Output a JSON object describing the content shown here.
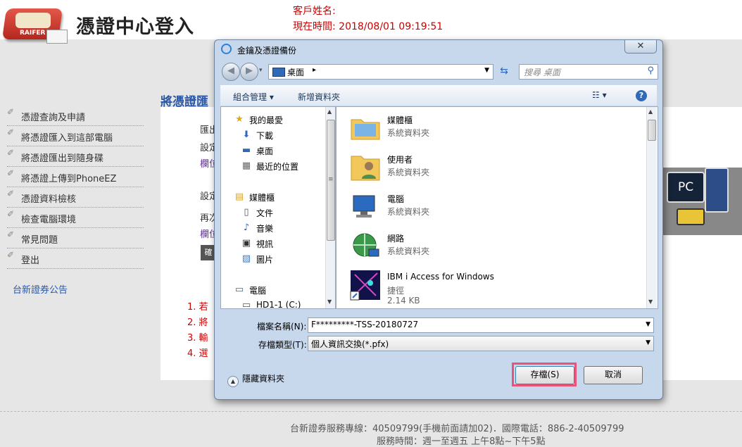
{
  "header": {
    "logo_text": "RAIFER",
    "title": "憑證中心登入",
    "customer_label": "客戶姓名:",
    "time_label": "現在時間: 2018/08/01 09:19:51"
  },
  "sidebar": {
    "items": [
      {
        "label": "憑證查詢及申請"
      },
      {
        "label": "將憑證匯入到這部電腦"
      },
      {
        "label": "將憑證匯出到隨身碟"
      },
      {
        "label": "將憑證上傳到PhoneEZ"
      },
      {
        "label": "憑證資料檢核"
      },
      {
        "label": "檢查電腦環境"
      },
      {
        "label": "常見問題"
      },
      {
        "label": "登出"
      }
    ],
    "notice": "台新證券公告"
  },
  "main": {
    "section_title": "將憑證匯",
    "fragments": [
      "匯出",
      "設定",
      "欄位",
      "設定",
      "再次",
      "欄位"
    ],
    "gray_button": "確",
    "list_numbers": [
      "1. 若",
      "2. 將",
      "3. 輸",
      "4. 選"
    ],
    "pc_label": "PC"
  },
  "footer": {
    "line1": "台新證券服務專線：40509799(手機前面請加02)．國際電話：886-2-40509799",
    "line2": "服務時間：週一至週五 上午8點~下午5點"
  },
  "dialog": {
    "title": "金鑰及憑證備份",
    "close": "✕",
    "address": "桌面",
    "search_placeholder": "搜尋 桌面",
    "toolbar": {
      "organize": "組合管理 ▾",
      "new_folder": "新增資料夾",
      "help": "?"
    },
    "nav_pane": [
      {
        "label": "我的最愛",
        "icon": "star-icon"
      },
      {
        "label": "下載",
        "icon": "download-folder-icon"
      },
      {
        "label": "桌面",
        "icon": "desktop-icon"
      },
      {
        "label": "最近的位置",
        "icon": "recent-places-icon"
      },
      {
        "label": "媒體櫃",
        "icon": "library-icon"
      },
      {
        "label": "文件",
        "icon": "documents-icon"
      },
      {
        "label": "音樂",
        "icon": "music-icon"
      },
      {
        "label": "視訊",
        "icon": "video-icon"
      },
      {
        "label": "圖片",
        "icon": "pictures-icon"
      },
      {
        "label": "電腦",
        "icon": "computer-icon"
      },
      {
        "label": "HD1-1 (C:)",
        "icon": "drive-icon"
      }
    ],
    "files": [
      {
        "name": "媒體櫃",
        "type": "系統資料夾",
        "icon": "library-folder-icon"
      },
      {
        "name": "使用者",
        "type": "系統資料夾",
        "icon": "user-folder-icon"
      },
      {
        "name": "電腦",
        "type": "系統資料夾",
        "icon": "computer-icon"
      },
      {
        "name": "網路",
        "type": "系統資料夾",
        "icon": "network-icon"
      },
      {
        "name": "IBM i Access for Windows",
        "type": "捷徑",
        "size": "2.14 KB",
        "icon": "shortcut-icon"
      }
    ],
    "filename_label": "檔案名稱(N):",
    "filename_value": "F*********-TSS-20180727",
    "filetype_label": "存檔類型(T):",
    "filetype_value": "個人資訊交換(*.pfx)",
    "hide_folders": "隱藏資料夾",
    "save_button": "存檔(S)",
    "cancel_button": "取消",
    "colors": {
      "highlight": "#e9537a",
      "accent": "#2f69b8"
    }
  }
}
